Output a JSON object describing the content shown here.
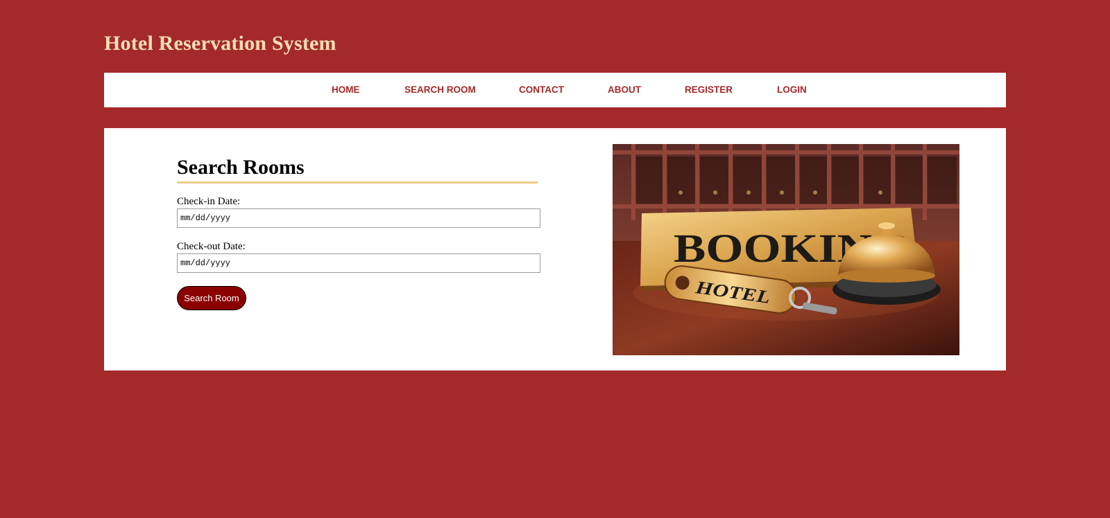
{
  "header": {
    "title": "Hotel Reservation System"
  },
  "nav": {
    "items": [
      {
        "label": "HOME"
      },
      {
        "label": "SEARCH ROOM"
      },
      {
        "label": "CONTACT"
      },
      {
        "label": "ABOUT"
      },
      {
        "label": "REGISTER"
      },
      {
        "label": "LOGIN"
      }
    ]
  },
  "search_form": {
    "heading": "Search Rooms",
    "checkin_label": "Check-in Date:",
    "checkin_placeholder": "mm/dd/yyyy",
    "checkout_label": "Check-out Date:",
    "checkout_placeholder": "mm/dd/yyyy",
    "submit_label": "Search Room"
  },
  "hero": {
    "sign_text": "BOOKING",
    "keytag_text": "HOTEL"
  },
  "colors": {
    "page_background": "#a4292b",
    "title_text": "#f7dfb4",
    "nav_text": "#a4292b",
    "heading_underline": "#efcb8a",
    "button_background": "#8b0000"
  }
}
